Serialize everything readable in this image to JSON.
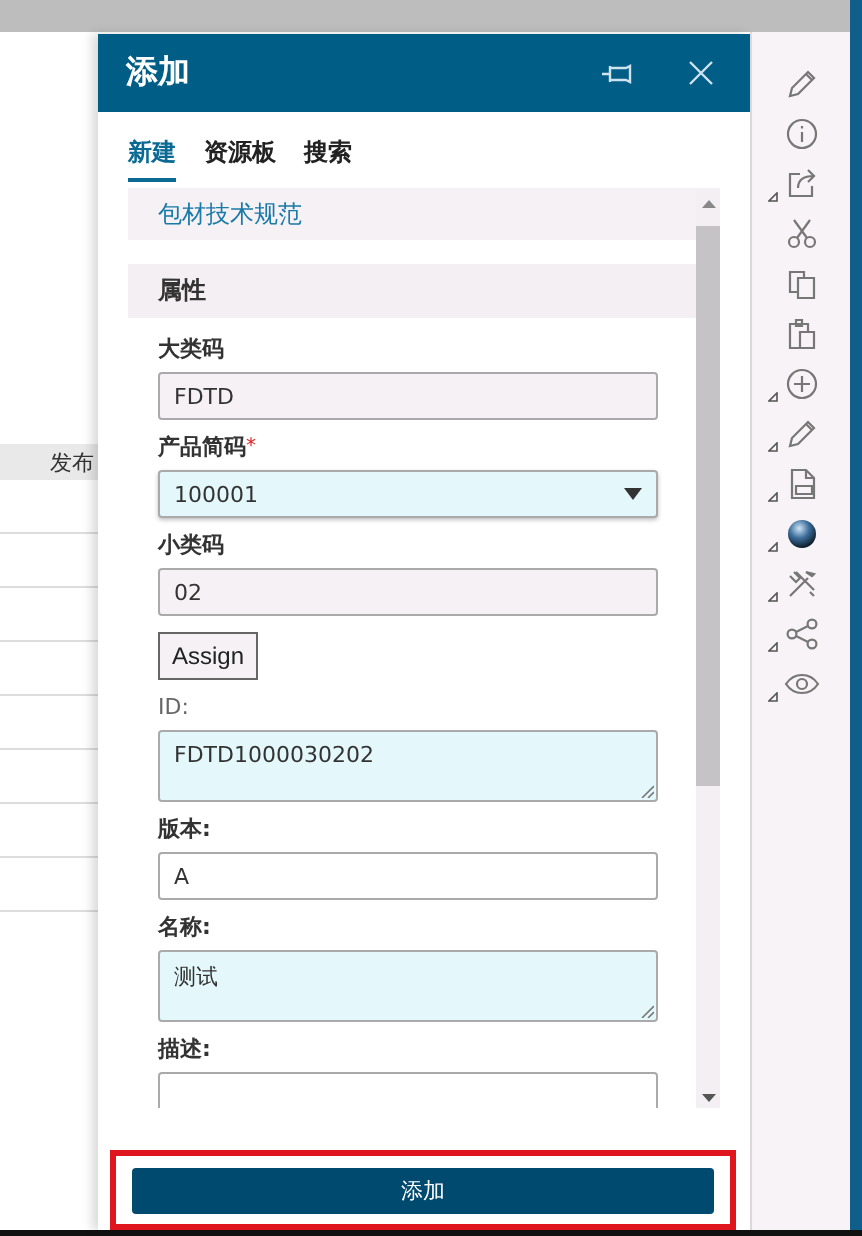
{
  "background_table": {
    "columns": [
      "发布"
    ]
  },
  "dialog": {
    "title": "添加",
    "tabs": [
      {
        "label": "新建",
        "selected": true
      },
      {
        "label": "资源板",
        "selected": false
      },
      {
        "label": "搜索",
        "selected": false
      }
    ],
    "type_link": "包材技术规范",
    "section": "属性",
    "fields": [
      {
        "kind": "text",
        "label": "大类码",
        "value": "FDTD",
        "readonly": true,
        "highlighted": false
      },
      {
        "kind": "select",
        "label": "产品简码",
        "required_mark": "*",
        "value": "100001",
        "readonly": false,
        "highlighted": true
      },
      {
        "kind": "text",
        "label": "小类码",
        "value": "02",
        "readonly": true,
        "highlighted": false
      },
      {
        "kind": "button",
        "label": "Assign"
      },
      {
        "kind": "textarea",
        "label": "ID:",
        "value": "FDTD1000030202",
        "readonly": false,
        "highlighted": true
      },
      {
        "kind": "text",
        "label": "版本:",
        "value": "A",
        "readonly": false,
        "highlighted": false
      },
      {
        "kind": "textarea",
        "label": "名称:",
        "value": "测试",
        "readonly": false,
        "highlighted": true
      },
      {
        "kind": "textarea",
        "label": "描述:",
        "readonly": false,
        "highlighted": false
      }
    ],
    "submit": {
      "label": "添加",
      "outlined": true
    }
  },
  "toolbar": [
    {
      "kind": "pencil",
      "has_menu": false
    },
    {
      "kind": "info",
      "has_menu": false
    },
    {
      "kind": "export",
      "has_menu": true
    },
    {
      "kind": "scissors",
      "has_menu": false
    },
    {
      "kind": "copy",
      "has_menu": false
    },
    {
      "kind": "paste",
      "has_menu": false
    },
    {
      "kind": "add",
      "has_menu": true
    },
    {
      "kind": "pencil",
      "has_menu": true
    },
    {
      "kind": "document",
      "has_menu": true
    },
    {
      "kind": "sphere",
      "has_menu": true
    },
    {
      "kind": "tools",
      "has_menu": true
    },
    {
      "kind": "share",
      "has_menu": true
    },
    {
      "kind": "eye",
      "has_menu": true
    }
  ]
}
